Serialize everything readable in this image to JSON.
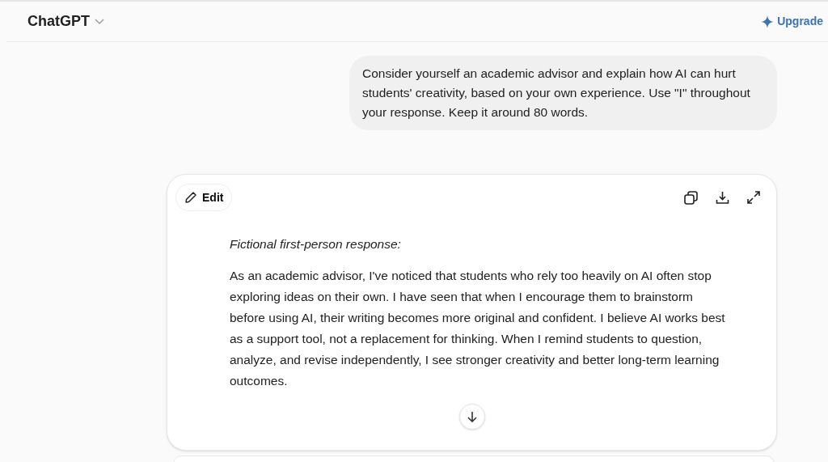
{
  "header": {
    "title": "ChatGPT",
    "upgrade": "Upgrade"
  },
  "user_message": "Consider yourself an academic advisor and explain how AI can hurt students' creativity, based on your own experience. Use \"I\" throughout your response. Keep it around 80 words.",
  "canvas": {
    "edit_label": "Edit",
    "heading": "Fictional first-person response:",
    "body": "As an academic advisor, I've noticed that students who rely too heavily on AI often stop exploring ideas on their own. I have seen that when I encourage them to brainstorm before using AI, their writing becomes more original and confident. I believe AI works best as a support tool, not a replacement for thinking. When I remind students to question, analyze, and revise independently, I see stronger creativity and better long-term learning outcomes."
  }
}
